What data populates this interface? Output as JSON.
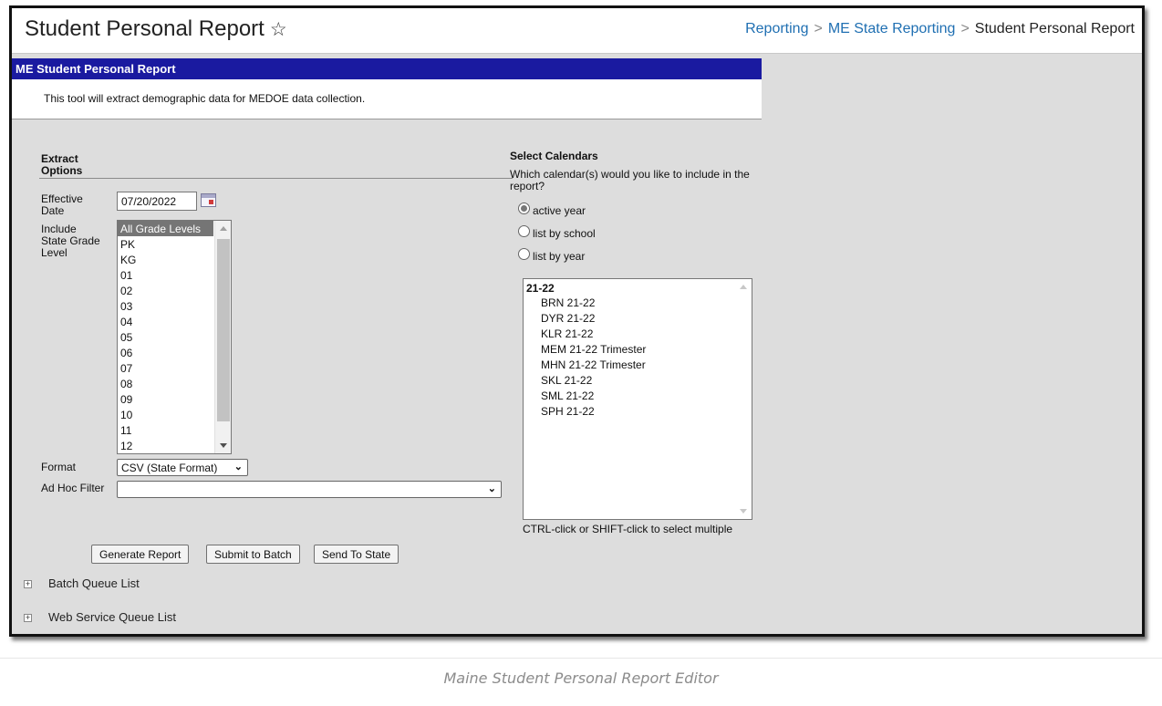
{
  "header": {
    "title": "Student Personal Report",
    "star_icon": "star-outline-icon",
    "breadcrumb": [
      "Reporting",
      "ME State Reporting",
      "Student Personal Report"
    ]
  },
  "panel": {
    "title": "ME Student Personal Report",
    "description": "This tool will extract demographic data for MEDOE data collection.",
    "header_color": "#1a1aa0"
  },
  "extract_options": {
    "heading_line1": "Extract",
    "heading_line2": "Options",
    "effective_date_label_1": "Effective",
    "effective_date_label_2": "Date",
    "effective_date_value": "07/20/2022",
    "grade_label_1": "Include",
    "grade_label_2": "State Grade",
    "grade_label_3": "Level",
    "grade_levels": [
      "All Grade Levels",
      "PK",
      "KG",
      "01",
      "02",
      "03",
      "04",
      "05",
      "06",
      "07",
      "08",
      "09",
      "10",
      "11",
      "12"
    ],
    "grade_selected": "All Grade Levels",
    "format_label": "Format",
    "format_value": "CSV (State Format)",
    "adhoc_label": "Ad Hoc Filter",
    "adhoc_value": ""
  },
  "calendars": {
    "heading": "Select Calendars",
    "question": "Which calendar(s) would you like to include in the report?",
    "radio_options": [
      "active year",
      "list by school",
      "list by year"
    ],
    "radio_selected": "active year",
    "group": "21-22",
    "items": [
      "BRN 21-22",
      "DYR 21-22",
      "KLR 21-22",
      "MEM 21-22 Trimester",
      "MHN 21-22 Trimester",
      "SKL 21-22",
      "SML 21-22",
      "SPH 21-22"
    ],
    "hint": "CTRL-click or SHIFT-click to select multiple"
  },
  "buttons": {
    "generate": "Generate Report",
    "batch": "Submit to Batch",
    "send": "Send To State"
  },
  "queues": {
    "batch": "Batch Queue List",
    "web_service": "Web Service Queue List",
    "expand_symbol": "+"
  },
  "caption": "Maine Student Personal Report Editor"
}
